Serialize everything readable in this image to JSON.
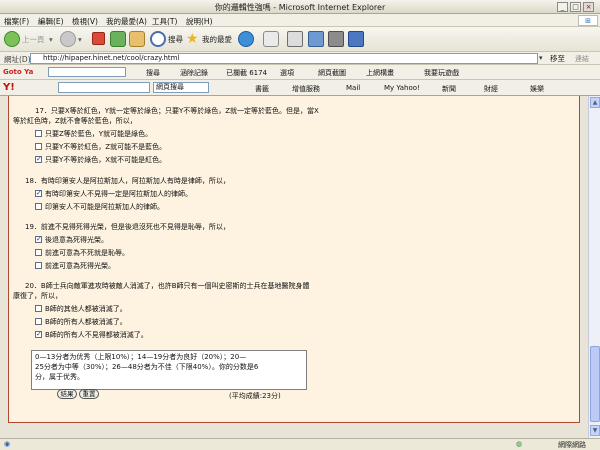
{
  "window": {
    "title": "你的邏輯性強嗎 - Microsoft Internet Explorer",
    "controls": [
      "_",
      "□",
      "×"
    ]
  },
  "menu": [
    "檔案(F)",
    "編輯(E)",
    "檢視(V)",
    "我的最愛(A)",
    "工具(T)",
    "說明(H)"
  ],
  "toolbar": {
    "back": "上一頁",
    "search": "搜尋",
    "favorites": "我的最愛"
  },
  "address": {
    "label": "網址(D)",
    "url": "http://hipaper.hinet.net/cool/crazy.html",
    "go": "移至",
    "links": "連結"
  },
  "goto_toolbar": {
    "logo": "Goto Ya",
    "search": "搜尋",
    "clear": "涵除記錄",
    "blocked": "已攔截 6174",
    "options": "選項",
    "web_shot": "網頁截圖",
    "online_game": "上網構畫",
    "want_game": "我要玩遊戲"
  },
  "yahoo_toolbar": {
    "logo": "Y!",
    "search_select": "網頁搜尋",
    "bookmarks": "書籤",
    "add_service": "增值服務",
    "mail": "Mail",
    "my_yahoo": "My Yahoo!",
    "news": "新聞",
    "finance": "財經",
    "entertainment": "娛樂"
  },
  "quiz": {
    "q17": {
      "text_1": "17．只要X等於紅色，Y就一定等於綠色；只要Y不等於綠色，Z就一定等於藍色。但是，當X",
      "text_2": "等於紅色時，Z就不會等於藍色，所以，",
      "options": [
        {
          "label": "只要Z等於藍色，Y就可能是綠色。",
          "checked": false
        },
        {
          "label": "只要Y不等於紅色，Z就可能不是藍色。",
          "checked": false
        },
        {
          "label": "只要Y不等於綠色，X就不可能是紅色。",
          "checked": true
        }
      ]
    },
    "q18": {
      "text": "18．有時印第安人是阿拉斯加人，阿拉斯加人有時是律師，所以，",
      "options": [
        {
          "label": "有時印第安人不見得一定是阿拉斯加人的律師。",
          "checked": true
        },
        {
          "label": "印第安人不可能是阿拉斯加人的律師。",
          "checked": false
        }
      ]
    },
    "q19": {
      "text": "19．前進不見得死得光榮，但是後退沒死也不見得是恥辱，所以，",
      "options": [
        {
          "label": "後退意為死得光榮。",
          "checked": true
        },
        {
          "label": "前進可意為不死就是恥辱。",
          "checked": false
        },
        {
          "label": "前進可意為死得光榮。",
          "checked": false
        }
      ]
    },
    "q20": {
      "text_1": "20．B師士兵向敵軍進攻時被敵人消滅了，也許B師只有一個叫史密斯的士兵在基地醫院身體",
      "text_2": "康復了，所以，",
      "options": [
        {
          "label": "B師的其他人都被消滅了。",
          "checked": false
        },
        {
          "label": "B師的所有人都被消滅了。",
          "checked": false
        },
        {
          "label": "B師的所有人不見得都被消滅了。",
          "checked": true
        }
      ]
    }
  },
  "result": {
    "line1": "0—13分者为优秀（上限10%）；14—19分者为良好（20%）；20—",
    "line2": "25分者为中等（30%）；26—48分者为不佳（下限40%）。你的分数是6",
    "line3": "分，属于优秀。",
    "submit": "結果",
    "reset": "重置",
    "average": "(平均成績:23分)"
  },
  "status": {
    "zone": "網際網路"
  }
}
